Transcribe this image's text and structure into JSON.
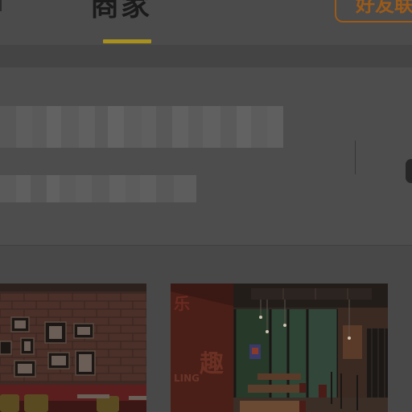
{
  "tab": {
    "title": "商家",
    "action_label": "好友联"
  },
  "info": {
    "name_redacted": "",
    "address_redacted": ""
  },
  "gallery": {
    "photos": [
      {
        "alt": ""
      },
      {
        "alt": ""
      }
    ]
  },
  "colors": {
    "overlay": "#4b4b4b",
    "tab_indicator": "#a8901e",
    "action_border": "#9a5a1a"
  },
  "icons": {
    "side_handle": "side-handle-icon"
  }
}
